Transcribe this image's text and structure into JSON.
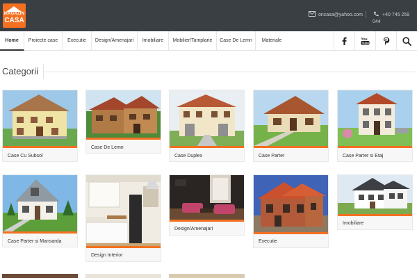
{
  "brand": {
    "line1": "MAGAZIN",
    "line2": "CASA"
  },
  "contact": {
    "email": "oncasa@yahoo.com",
    "phone": "+40 745 259 044"
  },
  "nav": {
    "items": [
      {
        "label": "Home",
        "active": true
      },
      {
        "label": "Proiecte case"
      },
      {
        "label": "Executie"
      },
      {
        "label": "Design/Amenajari"
      },
      {
        "label": "Imobiliare"
      },
      {
        "label": "Mobilier/Tamplarie"
      },
      {
        "label": "Case De Lemn"
      },
      {
        "label": "Materiale"
      }
    ],
    "social": [
      "facebook-icon",
      "youtube-icon",
      "pinterest-icon",
      "search-icon"
    ]
  },
  "section": {
    "title": "Categorii"
  },
  "categories": [
    {
      "label": "Case Cu Subsol"
    },
    {
      "label": "Case De Lemn"
    },
    {
      "label": "Case Duplex"
    },
    {
      "label": "Case Parter"
    },
    {
      "label": "Case Parter si Etaj"
    },
    {
      "label": "Case Parter si Mansarda"
    },
    {
      "label": "Design Interior"
    },
    {
      "label": "Design/Amenajari"
    },
    {
      "label": "Executie"
    },
    {
      "label": "Imobiliare"
    }
  ],
  "colors": {
    "accent": "#f37021",
    "topbar": "#3a3f44"
  }
}
